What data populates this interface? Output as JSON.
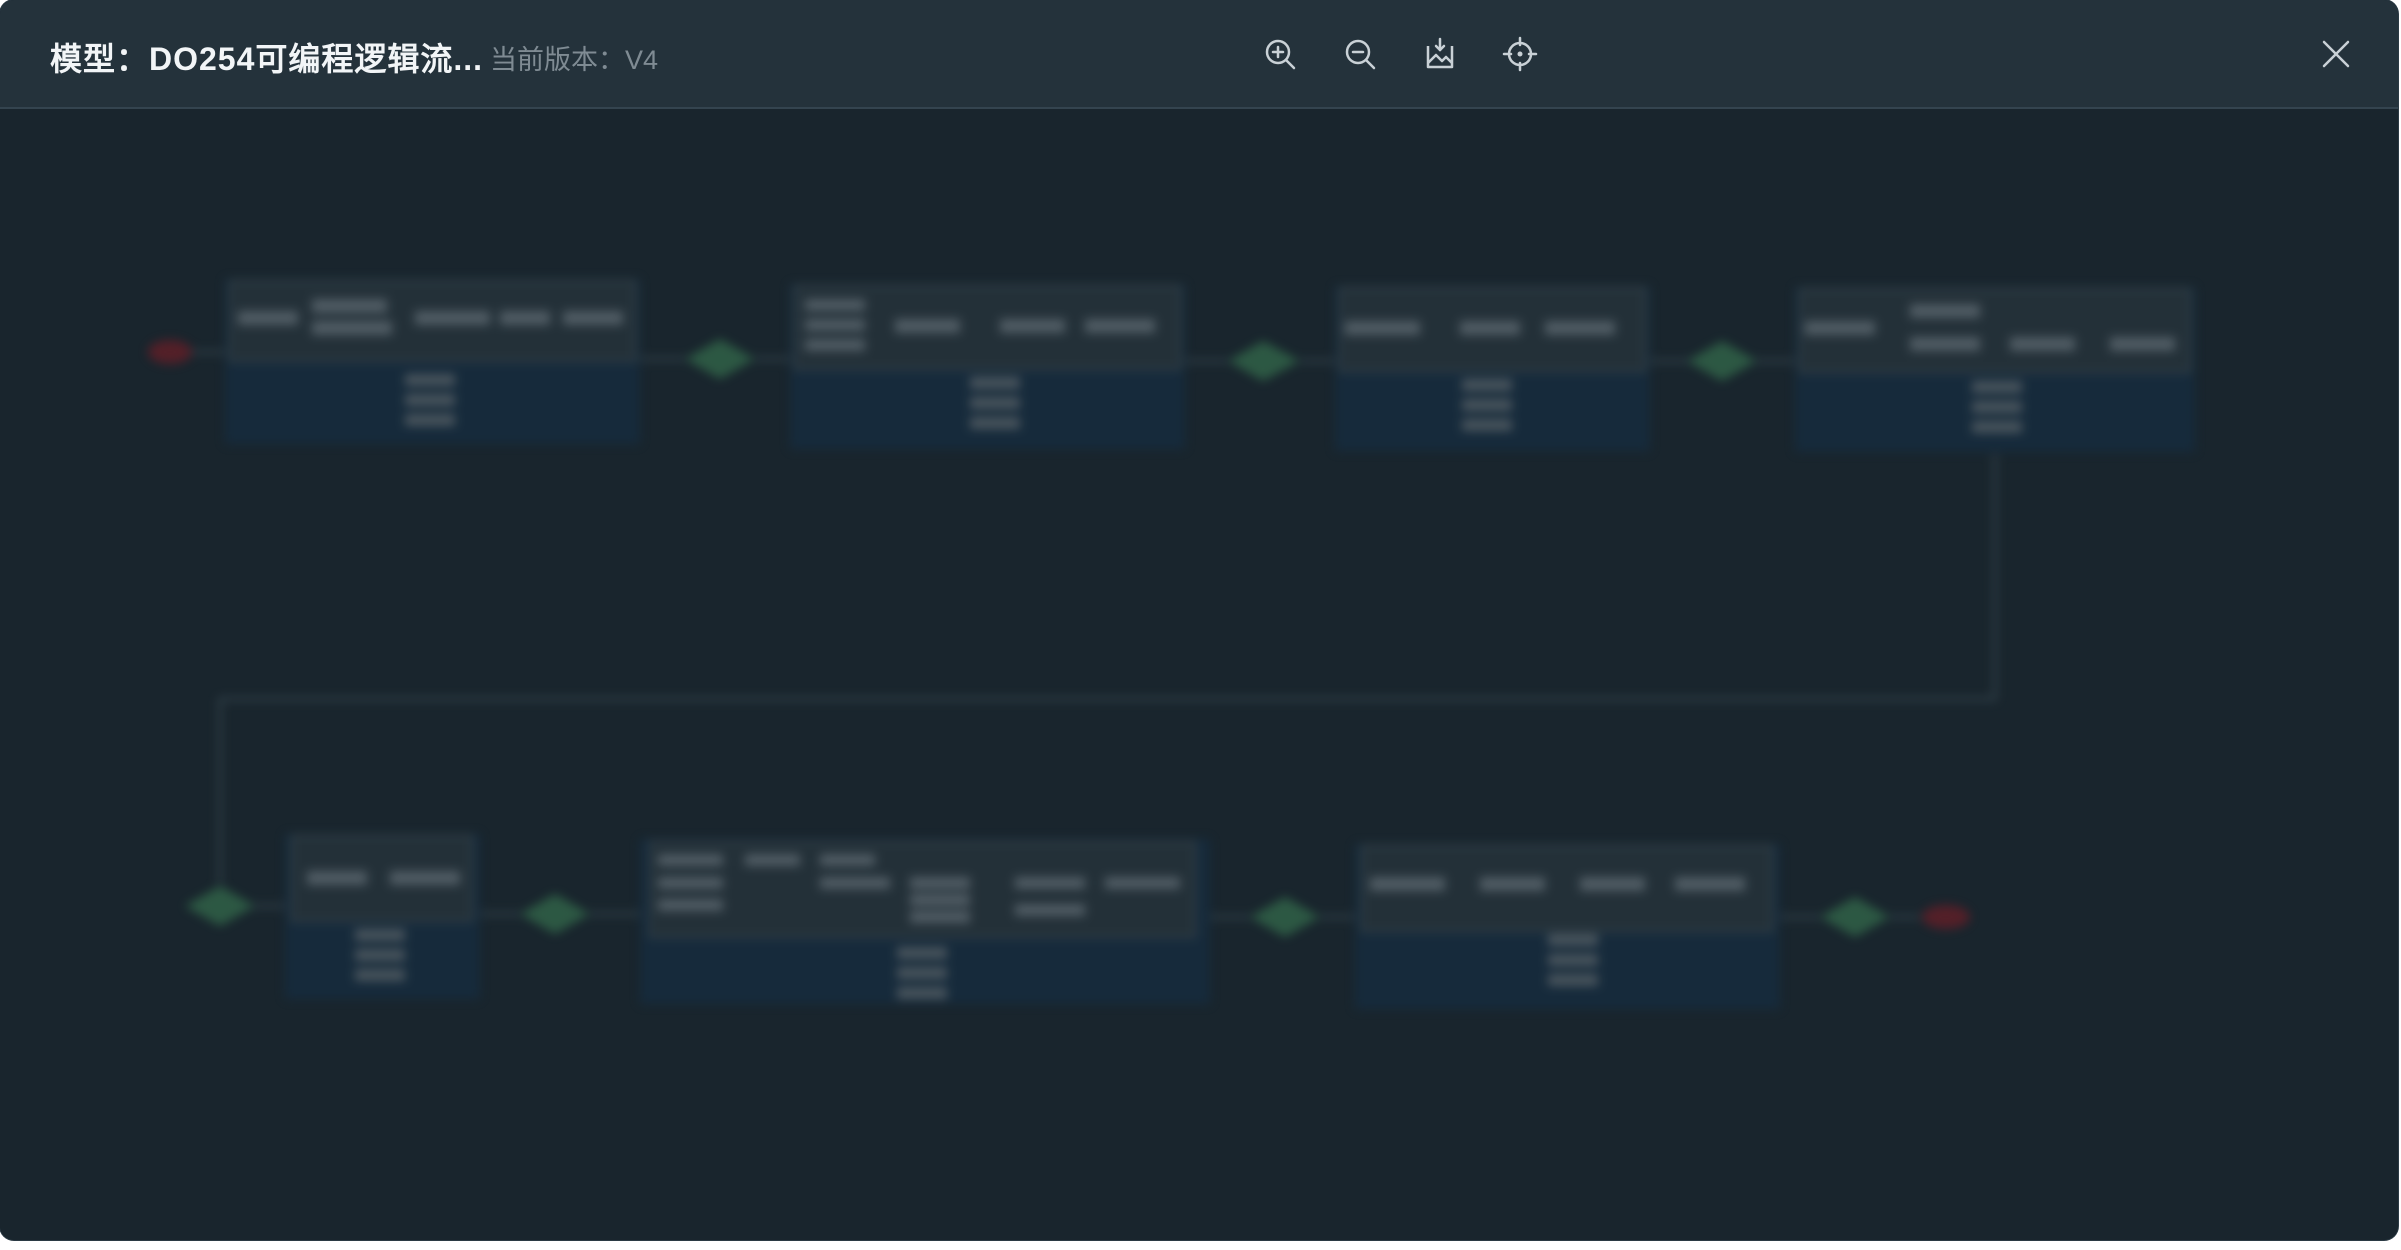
{
  "header": {
    "title": "模型：DO254可编程逻辑流...",
    "version": "当前版本：V4"
  },
  "toolbar": {
    "tools": [
      {
        "icon": "zoom-in-icon"
      },
      {
        "icon": "zoom-out-icon"
      },
      {
        "icon": "export-image-icon"
      },
      {
        "icon": "locate-icon"
      }
    ],
    "close_icon": "close-icon"
  },
  "colors": {
    "background": "#19252d",
    "header": "#24323b",
    "stage_fill": "#162b3d",
    "stage_inner": "#25323a",
    "gateway": "#2f5e46",
    "endpoint": "#5a1f28",
    "connector": "#3a4a53"
  }
}
